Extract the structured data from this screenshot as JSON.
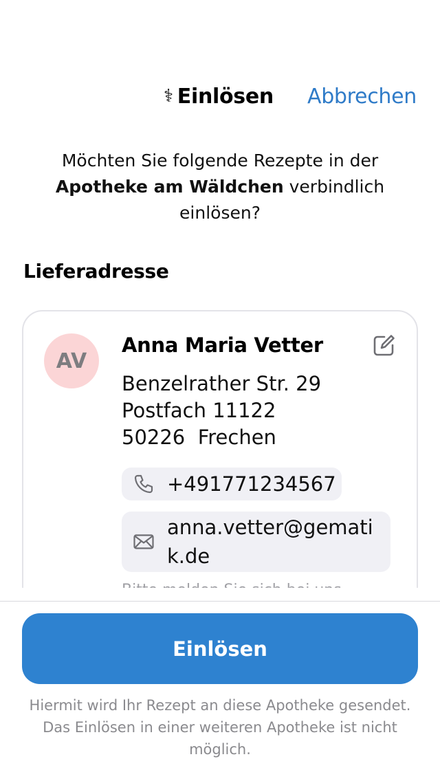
{
  "header": {
    "title_icon": "caduceus-icon",
    "title_glyph": "⚕",
    "title": "Einlösen",
    "cancel_label": "Abbrechen"
  },
  "question": {
    "prefix": "Möchten Sie folgende Rezepte in der",
    "pharmacy": "Apotheke am Wäldchen",
    "suffix": "verbindlich einlösen?"
  },
  "delivery": {
    "section_title": "Lieferadresse",
    "avatar_initials": "AV",
    "name": "Anna Maria Vetter",
    "address_lines": [
      "Benzelrather Str. 29",
      "Postfach 11122",
      "50226  Frechen"
    ],
    "phone": "+491771234567",
    "email": "anna.vetter@gematik.de",
    "partial_text": "Bitte melden Sie sich bei uns"
  },
  "action": {
    "button_label": "Einlösen",
    "footnote": "Hiermit wird Ihr Rezept an diese Apotheke gesendet. Das Einlösen in einer weiteren Apotheke ist nicht möglich."
  },
  "colors": {
    "accent": "#2e82d0",
    "link": "#2f7bc8",
    "avatar_bg": "#fbd5d6",
    "chip_bg": "#f0f0f5"
  }
}
